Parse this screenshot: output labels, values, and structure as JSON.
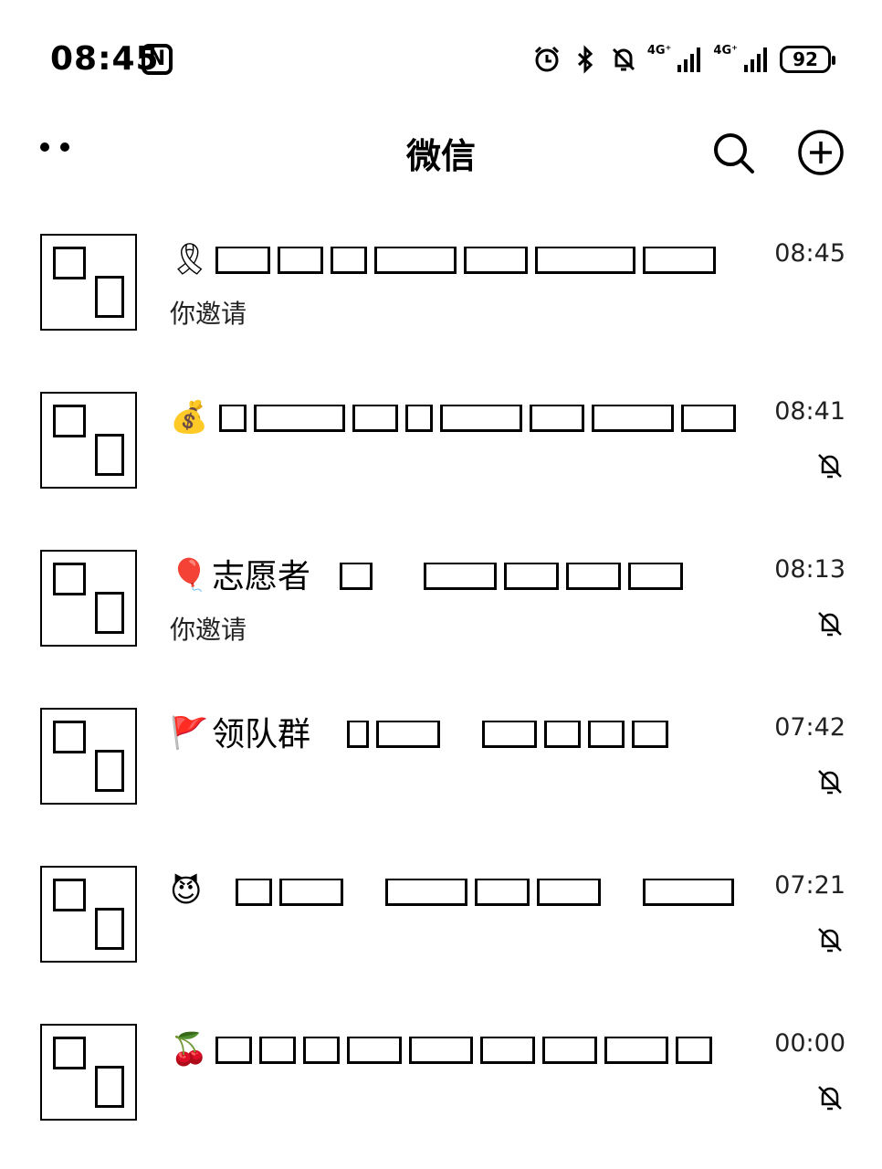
{
  "status_bar": {
    "time": "08:45",
    "nfc_label": "N",
    "battery": "92",
    "icons": [
      "alarm-icon",
      "bluetooth-icon",
      "mute-bell-icon",
      "signal-4g-icon",
      "signal-4g-icon-2",
      "battery-icon"
    ],
    "signal_label_1": "4G⁺",
    "signal_label_2": "4G⁺"
  },
  "header": {
    "title": "微信",
    "more_icon": "more-dots-icon",
    "search_icon": "search-icon",
    "add_icon": "plus-circle-icon"
  },
  "chats": [
    {
      "emoji": "🎗",
      "name": "",
      "preview": "你邀请",
      "time": "08:45",
      "muted": false
    },
    {
      "emoji": "💰",
      "name": "",
      "preview": "",
      "time": "08:41",
      "muted": true
    },
    {
      "emoji": "🎈",
      "name": "志愿者",
      "preview": "你邀请",
      "time": "08:13",
      "muted": true
    },
    {
      "emoji": "🚩",
      "name": "领队群",
      "preview": "",
      "time": "07:42",
      "muted": true
    },
    {
      "emoji": "😈",
      "name": "",
      "preview": "",
      "time": "07:21",
      "muted": true
    },
    {
      "emoji": "🍒",
      "name": "",
      "preview": "",
      "time": "00:00",
      "muted": true
    }
  ]
}
